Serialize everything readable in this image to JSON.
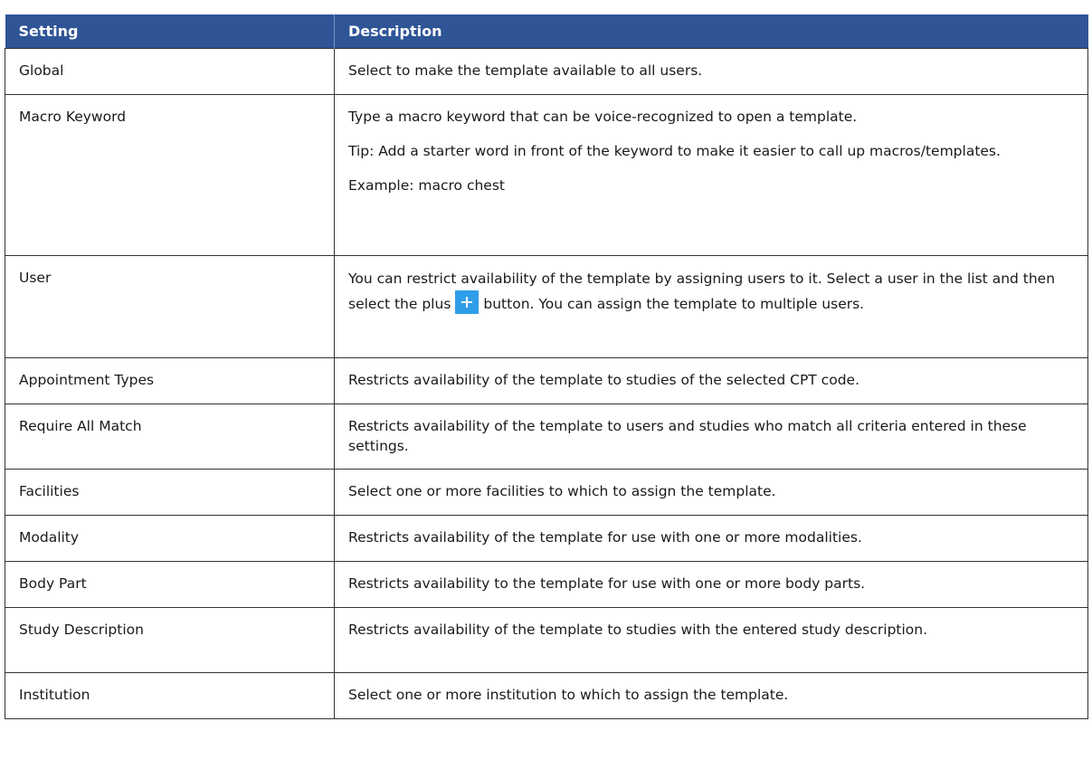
{
  "table": {
    "headers": {
      "setting": "Setting",
      "description": "Description"
    },
    "rows": [
      {
        "setting": "Global",
        "description": "Select to make the template available to all users."
      },
      {
        "setting": "Macro Keyword",
        "description": "Type a macro keyword that can be voice-recognized to open a template.",
        "tip": "Tip: Add a starter word in front of the keyword to make it easier to call up macros/templates.",
        "example": "Example: macro chest"
      },
      {
        "setting": "User",
        "description_before_icon": "You can restrict availability of the template by assigning users to it. Select a user in the list and then select the plus",
        "description_after_icon": "button. You can assign the template to multiple users.",
        "icon": "plus-icon"
      },
      {
        "setting": "Appointment Types",
        "description": "Restricts availability of the template to studies of the selected CPT code."
      },
      {
        "setting": "Require All Match",
        "description": "Restricts availability of the template to users and studies who match all criteria entered in these settings."
      },
      {
        "setting": "Facilities",
        "description": "Select one or more facilities to which to assign the template."
      },
      {
        "setting": "Modality",
        "description": "Restricts availability of the template for use with one or more modalities."
      },
      {
        "setting": "Body Part",
        "description": "Restricts availability to the template for use with one or more body parts."
      },
      {
        "setting": "Study Description",
        "description": "Restricts availability of the template to studies with the entered study description."
      },
      {
        "setting": "Institution",
        "description": "Select one or more institution to which to assign the template."
      }
    ]
  },
  "colors": {
    "header_bg": "#2f5597",
    "header_text": "#ffffff",
    "icon_bg": "#2e9ee8",
    "border": "#333333"
  }
}
